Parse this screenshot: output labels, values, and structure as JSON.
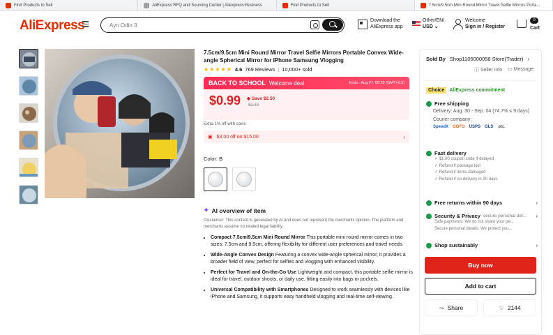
{
  "browser": {
    "tabs": [
      {
        "label": "Find Products to Sell"
      },
      {
        "label": "AliExpress RFQ and Sourcing Center | Aliexpress Business"
      },
      {
        "label": "Find Products to Sell"
      },
      {
        "label": "7.5cm/9.5cm Mini Round Mirror Travel Selfie Mirrors Porta..."
      }
    ]
  },
  "header": {
    "logo": "AliExpress",
    "search_placeholder": "Ayn Odin 3",
    "download_line1": "Download the",
    "download_line2": "AliExpress app",
    "region_line1": "Other/EN/",
    "region_line2": "USD",
    "welcome_line1": "Welcome",
    "welcome_line2": "Sign in / Register",
    "cart_label": "Cart",
    "cart_count": "0"
  },
  "product": {
    "title": "7.5cm/9.5cm Mini Round Mirror Travel Selfie Mirrors Portable Convex Wide-angle Spherical Mirror for IPhone Samsung Vlogging",
    "rating": "4.6",
    "stars": "★★★★★",
    "reviews": "769 Reviews",
    "sold": "10,000+ sold",
    "deal_title": "BACK TO SCHOOL",
    "deal_sub": "Welcome deal",
    "deal_ends": "Ends : Aug 27, 09:29 (GMT+5.5)",
    "price": "$0.99",
    "save": "Save $2.50",
    "old_price": "$3.49",
    "coins": "Extra 1% off with coins",
    "coupon": "$3.00 off on $15.00",
    "color_label": "Color: B"
  },
  "ai_overview": {
    "title": "AI overview of item",
    "disclaimer": "Disclaimer: This content is generated by AI and does not represent the merchants opinion. The platform and merchants assume no related legal liability.",
    "bullets": [
      {
        "head": "Compact 7.5cm/9.5cm Mini Round Mirror",
        "body": " This portable mini round mirror comes in two sizes: 7.5cm and 9.5cm, offering flexibility for different user preferences and travel needs."
      },
      {
        "head": "Wide-Angle Convex Design",
        "body": " Featuring a convex wide-angle spherical mirror, it provides a broader field of view, perfect for selfies and vlogging with enhanced visibility."
      },
      {
        "head": "Perfect for Travel and On-the-Go Use",
        "body": " Lightweight and compact, this portable selfie mirror is ideal for travel, outdoor shoots, or daily use, fitting easily into bags or pockets."
      },
      {
        "head": "Universal Compatibility with Smartphones",
        "body": " Designed to work seamlessly with devices like iPhone and Samsung, it supports easy handheld vlogging and real-time self-viewing."
      }
    ]
  },
  "seller": {
    "sold_by_label": "Sold By",
    "store": "Shop1105000058 Store(Trader)",
    "seller_info": "Seller info",
    "message": "Message",
    "choice_badge": "Choice",
    "choice_text": "AliExpress commitment",
    "free_shipping": "Free shipping",
    "delivery": "Delivery: Aug. 30 - Sep. 04 (74.7% ≤ 9 days)",
    "courier_label": "Courier company:",
    "couriers": [
      "SpeedX",
      "GOFO",
      "USPS",
      "GLS",
      ",etc."
    ],
    "fast_delivery": "Fast delivery",
    "fast_items": [
      "$1.00 coupon code if delayed",
      "Refund if package lost",
      "Refund if items damaged",
      "Refund if no delivery in 30 days"
    ],
    "free_returns": "Free returns within 90 days",
    "security": "Security & Privacy",
    "security_tail": "secure personal det...",
    "security_items": [
      "Safe payments: We do not share your pe...",
      "Secure personal details: We protect you..."
    ],
    "shop_sustainably": "Shop sustainably",
    "buy_now": "Buy now",
    "add_to_cart": "Add to cart",
    "share": "Share",
    "wishlist": "2144"
  },
  "colors": {
    "brand": "#e62e04",
    "buy": "#e0241a",
    "price": "#e02020",
    "deal": "#ff2b54",
    "green": "#1a9c4a"
  }
}
